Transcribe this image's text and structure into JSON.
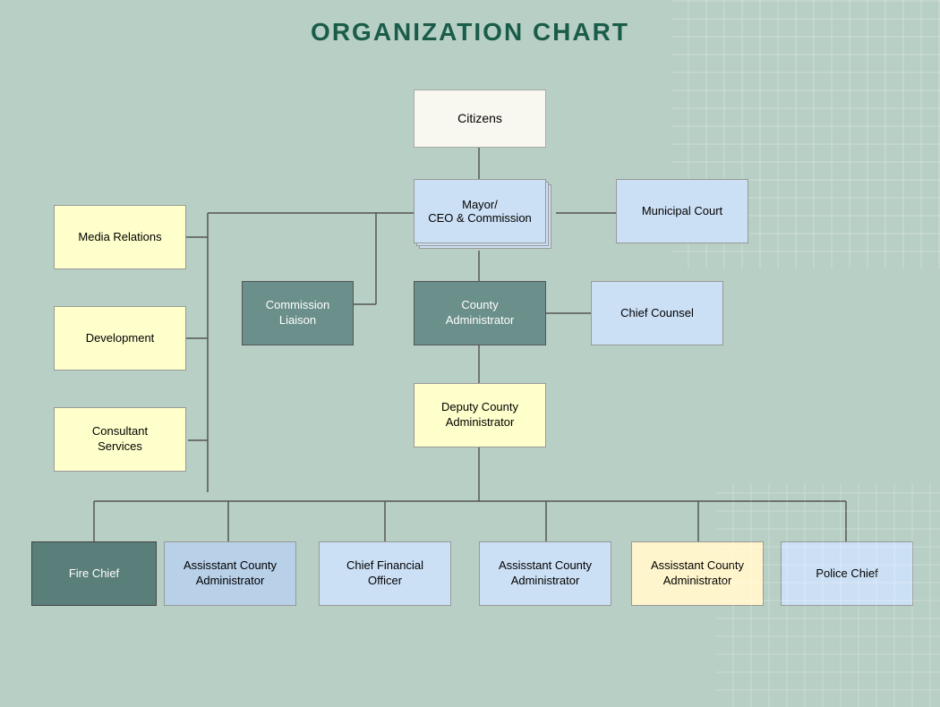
{
  "title": "ORGANIZATION CHART",
  "nodes": {
    "citizens": {
      "label": "Citizens"
    },
    "mayor": {
      "label": "Mayor/\nCEO & Commission"
    },
    "municipal_court": {
      "label": "Municipal Court"
    },
    "media_relations": {
      "label": "Media Relations"
    },
    "development": {
      "label": "Development"
    },
    "consultant_services": {
      "label": "Consultant\nServices"
    },
    "commission_liaison": {
      "label": "Commission\nLiaison"
    },
    "county_admin": {
      "label": "County\nAdministrator"
    },
    "chief_counsel": {
      "label": "Chief Counsel"
    },
    "deputy_county_admin": {
      "label": "Deputy County\nAdministrator"
    },
    "fire_chief": {
      "label": "Fire Chief"
    },
    "asst_county_admin_1": {
      "label": "Assisstant County\nAdministrator"
    },
    "chief_financial_officer": {
      "label": "Chief Financial\nOfficer"
    },
    "asst_county_admin_2": {
      "label": "Assisstant County\nAdministrator"
    },
    "asst_county_admin_3": {
      "label": "Assisstant County\nAdministrator"
    },
    "police_chief": {
      "label": "Police Chief"
    }
  },
  "colors": {
    "title": "#1a5c4a",
    "background": "#b8cfc5"
  }
}
